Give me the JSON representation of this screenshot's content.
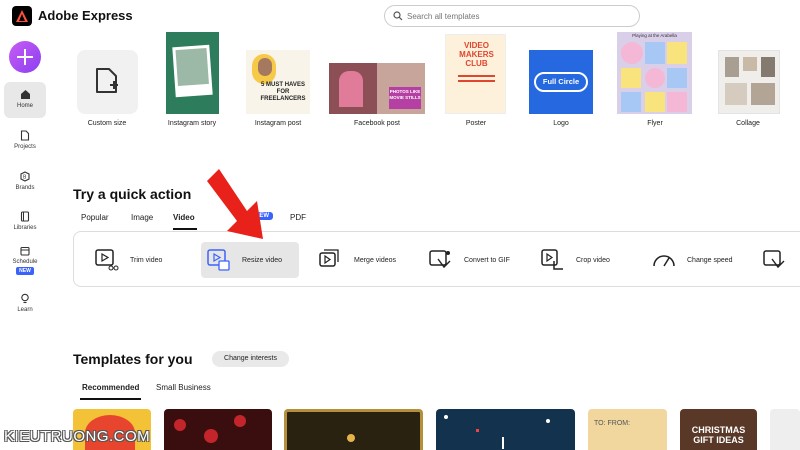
{
  "app": {
    "title": "Adobe Express"
  },
  "search": {
    "placeholder": "Search all templates"
  },
  "sidebar": {
    "items": [
      {
        "label": "Home"
      },
      {
        "label": "Projects"
      },
      {
        "label": "Brands"
      },
      {
        "label": "Libraries"
      },
      {
        "label": "Schedule",
        "badge": "NEW"
      },
      {
        "label": "Learn"
      }
    ]
  },
  "formats": [
    {
      "label": "Custom size"
    },
    {
      "label": "Instagram story"
    },
    {
      "label": "Instagram post",
      "art_text": "5 MUST HAVES FOR FREELANCERS"
    },
    {
      "label": "Facebook post",
      "art_text": "PHOTOS LIKE MOVIE STILLS"
    },
    {
      "label": "Poster",
      "art_text": "VIDEO MAKERS CLUB"
    },
    {
      "label": "Logo",
      "art_text": "Full Circle"
    },
    {
      "label": "Flyer",
      "art_text": "Playing at the Arabella"
    },
    {
      "label": "Collage"
    }
  ],
  "quick_action": {
    "title": "Try a quick action",
    "tabs": [
      {
        "label": "Popular"
      },
      {
        "label": "Image"
      },
      {
        "label": "Video"
      },
      {
        "label": "NEW"
      },
      {
        "label": "PDF"
      }
    ],
    "actions": [
      {
        "label": "Trim video"
      },
      {
        "label": "Resize video"
      },
      {
        "label": "Merge videos"
      },
      {
        "label": "Convert to GIF"
      },
      {
        "label": "Crop video"
      },
      {
        "label": "Change speed"
      }
    ]
  },
  "templates": {
    "title": "Templates for you",
    "change_label": "Change interests",
    "tabs": [
      {
        "label": "Recommended"
      },
      {
        "label": "Small Business"
      }
    ],
    "cards": [
      {
        "art_text": ""
      },
      {
        "art_text": ""
      },
      {
        "art_text": ""
      },
      {
        "art_text": ""
      },
      {
        "art_text": "TO: FROM:"
      },
      {
        "art_text": "CHRISTMAS GIFT IDEAS"
      }
    ]
  },
  "watermark": "KIEUTRUONG.COM",
  "colors": {
    "accent": "#8b3ff0",
    "badge": "#3b63fb",
    "arrow": "#e8221b"
  }
}
